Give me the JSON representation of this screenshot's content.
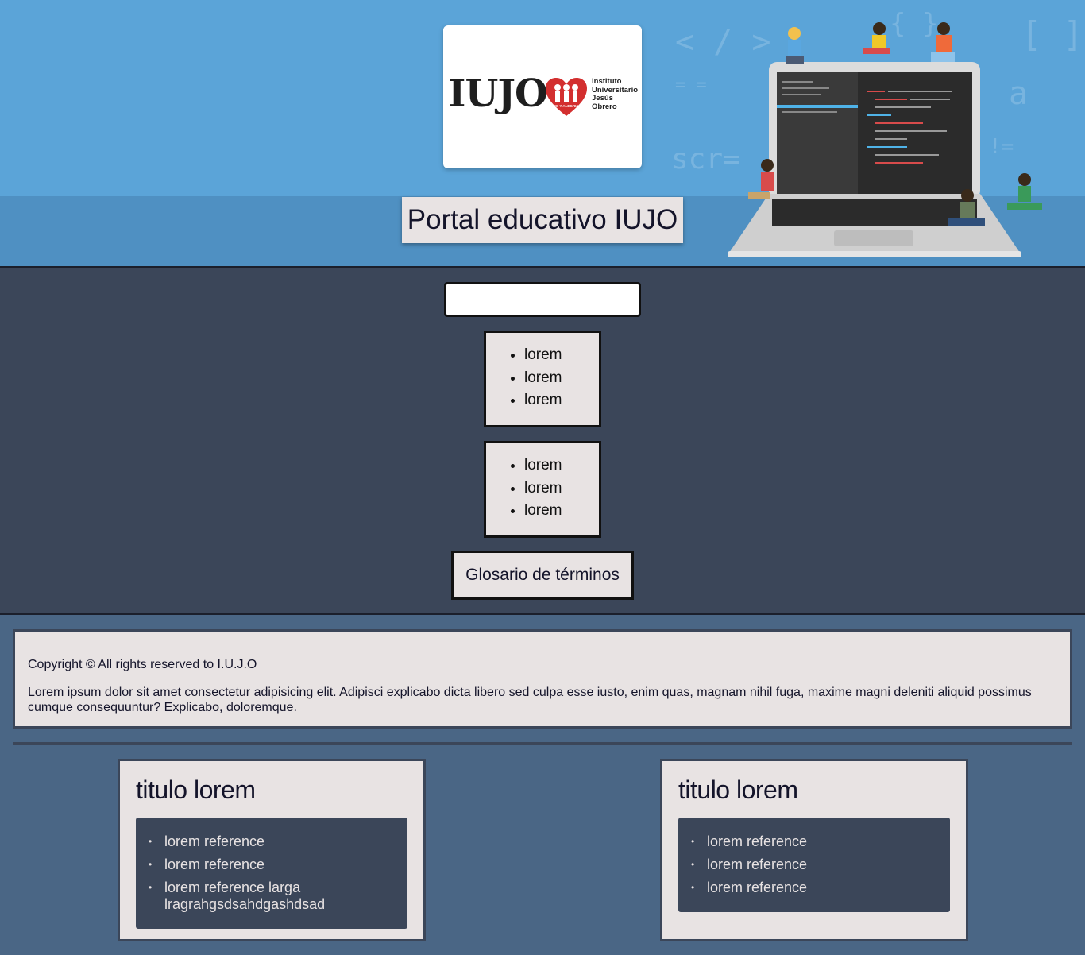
{
  "header": {
    "logo": {
      "wordmark": "IUJO",
      "heart_text": "FE Y ALEGRIA",
      "subtitle_lines": [
        "Instituto",
        "Universitario",
        "Jesús",
        "Obrero"
      ]
    },
    "title": "Portal educativo IUJO"
  },
  "nav": {
    "search": {
      "value": "",
      "placeholder": ""
    },
    "menus": [
      {
        "items": [
          "lorem",
          "lorem",
          "lorem"
        ]
      },
      {
        "items": [
          "lorem",
          "lorem",
          "lorem"
        ]
      }
    ],
    "glossary_label": "Glosario de términos"
  },
  "footer": {
    "copyright": "Copyright © All rights reserved to I.U.J.O",
    "lorem": "Lorem ipsum dolor sit amet consectetur adipisicing elit. Adipisci explicabo dicta libero sed culpa esse iusto, enim quas, magnam nihil fuga, maxime magni deleniti aliquid possimus cumque consequuntur? Explicabo, doloremque.",
    "cards": [
      {
        "title": "titulo lorem",
        "items": [
          "lorem reference",
          "lorem reference",
          "lorem reference larga lragrahgsdsahdgashdsad"
        ]
      },
      {
        "title": "titulo lorem",
        "items": [
          "lorem reference",
          "lorem reference",
          "lorem reference"
        ]
      }
    ]
  },
  "colors": {
    "header_bg": "#5ba4d8",
    "nav_bg": "#3b4659",
    "footer_bg": "#4a6685",
    "panel_bg": "#e8e3e3",
    "logo_red": "#d32f2f"
  }
}
